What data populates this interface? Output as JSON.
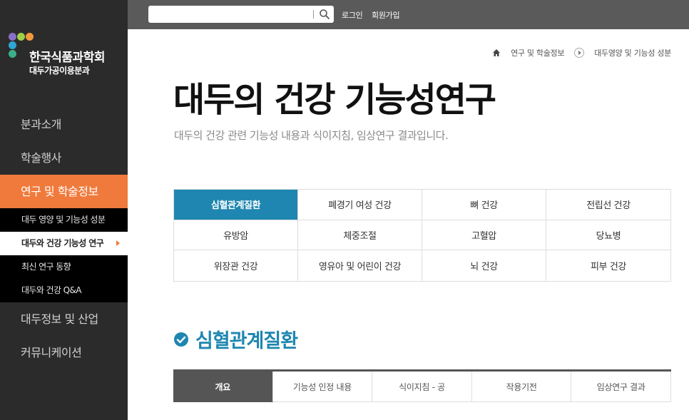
{
  "brand": {
    "name": "한국식품과학회",
    "division": "대두가공이용분과",
    "dot_colors": [
      "#8a6fc8",
      "#9fd04a",
      "#f39a3b",
      "#2ea6d6",
      "#3cb08a"
    ]
  },
  "topbar": {
    "search_placeholder": "",
    "login": "로그인",
    "signup": "회원가입"
  },
  "sidebar": {
    "items": [
      {
        "label": "분과소개"
      },
      {
        "label": "학술행사"
      },
      {
        "label": "연구 및 학술정보"
      },
      {
        "label": "대두정보 및 산업"
      },
      {
        "label": "커뮤니케이션"
      }
    ],
    "submenu": [
      {
        "label": "대두 영양 및 기능성 성분"
      },
      {
        "label": "대두와 건강 기능성 연구"
      },
      {
        "label": "최신 연구 동향"
      },
      {
        "label": "대두와 건강 Q&A"
      }
    ]
  },
  "breadcrumb": {
    "level1": "연구 및 학술정보",
    "level2": "대두영양 및 기능성 성분"
  },
  "page": {
    "title": "대두의 건강 기능성연구",
    "subtitle": "대두의 건강 관련 기능성 내용과 식이지침, 임상연구 결과입니다."
  },
  "categories": [
    "심혈관계질환",
    "폐경기 여성 건강",
    "뼈 건강",
    "전립선 건강",
    "유방암",
    "체중조절",
    "고혈압",
    "당뇨병",
    "위장관 건강",
    "영유아 및 어린이 건강",
    "뇌 건강",
    "피부 건강"
  ],
  "section": {
    "title": "심혈관계질환"
  },
  "tabs": [
    "개요",
    "기능성 인정 내용",
    "식이지침 - 공",
    "작용기전",
    "임상연구 결과"
  ],
  "colors": {
    "accent_orange": "#f07a3c",
    "accent_blue": "#1e86b0"
  }
}
